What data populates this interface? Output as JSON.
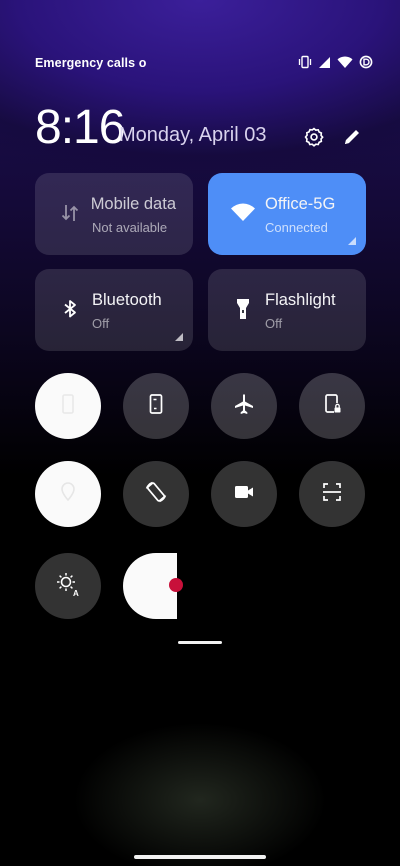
{
  "status_bar": {
    "carrier_text": "Emergency calls o",
    "icons": [
      "vibrate-icon",
      "signal-icon",
      "wifi-icon",
      "data-saver-icon"
    ]
  },
  "header": {
    "time": "8:16",
    "date": "Monday, April 03",
    "icons": [
      "settings-icon",
      "edit-icon"
    ]
  },
  "tiles": [
    {
      "id": "mobile-data",
      "title": "Mobile data",
      "subtitle": "Not available",
      "active": false,
      "icon": "mobile-data-icon"
    },
    {
      "id": "wifi",
      "title": "Office-5G",
      "subtitle": "Connected",
      "active": true,
      "icon": "wifi-icon"
    },
    {
      "id": "bluetooth",
      "title": "Bluetooth",
      "subtitle": "Off",
      "active": false,
      "icon": "bluetooth-icon"
    },
    {
      "id": "flashlight",
      "title": "Flashlight",
      "subtitle": "Off",
      "active": false,
      "icon": "flashlight-icon"
    }
  ],
  "toggles_row1": [
    "screen-icon",
    "screen-icon",
    "airplane-icon",
    "lock-screen-icon"
  ],
  "toggles_row2": [
    "location-icon",
    "auto-rotate-icon",
    "video-icon",
    "scanner-icon"
  ],
  "toggles_row3": [
    "auto-brightness-icon",
    "dark-mode-icon"
  ],
  "colors": {
    "accent": "#4e8ef7",
    "record_dot": "#c8103a"
  }
}
